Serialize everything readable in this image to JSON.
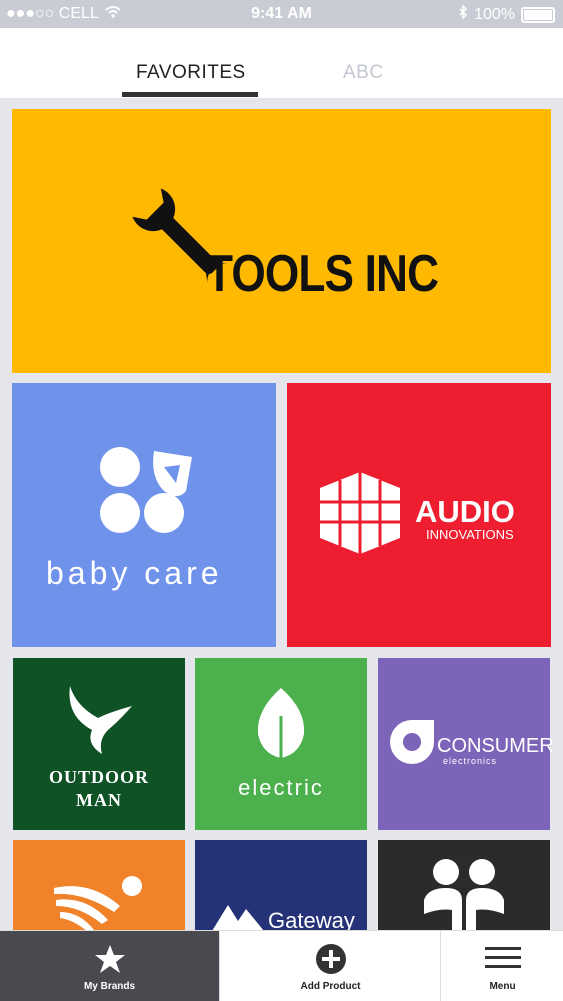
{
  "status_bar": {
    "carrier": "●●●○○ CELL",
    "time": "9:41 AM",
    "battery": "100%"
  },
  "tabs": [
    {
      "label": "FAVORITES",
      "active": true
    },
    {
      "label": "ABC",
      "active": false
    }
  ],
  "brands": {
    "tools": {
      "name": "TOOLS INC",
      "color": "#feb900"
    },
    "baby": {
      "name": "baby care",
      "color": "#6f93ea"
    },
    "audio": {
      "name": "AUDIO",
      "sub": "INNOVATIONS",
      "color": "#ee1d2f"
    },
    "outdoor": {
      "line1": "OUTDOOR",
      "line2": "MAN",
      "color": "#0e5226"
    },
    "electric": {
      "name": "electric",
      "color": "#4cb04c"
    },
    "consumer": {
      "name": "CONSUMER",
      "sub": "electronics",
      "color": "#7c64b9"
    },
    "orange": {
      "color": "#f0822a"
    },
    "gateway": {
      "name": "Gateway",
      "color": "#263278"
    },
    "people": {
      "color": "#2b2b2b"
    }
  },
  "bottom_nav": [
    {
      "label": "My Brands",
      "icon": "star-icon",
      "active": true
    },
    {
      "label": "Add Product",
      "icon": "plus-circle-icon",
      "active": false
    },
    {
      "label": "Menu",
      "icon": "hamburger-icon",
      "active": false
    }
  ]
}
